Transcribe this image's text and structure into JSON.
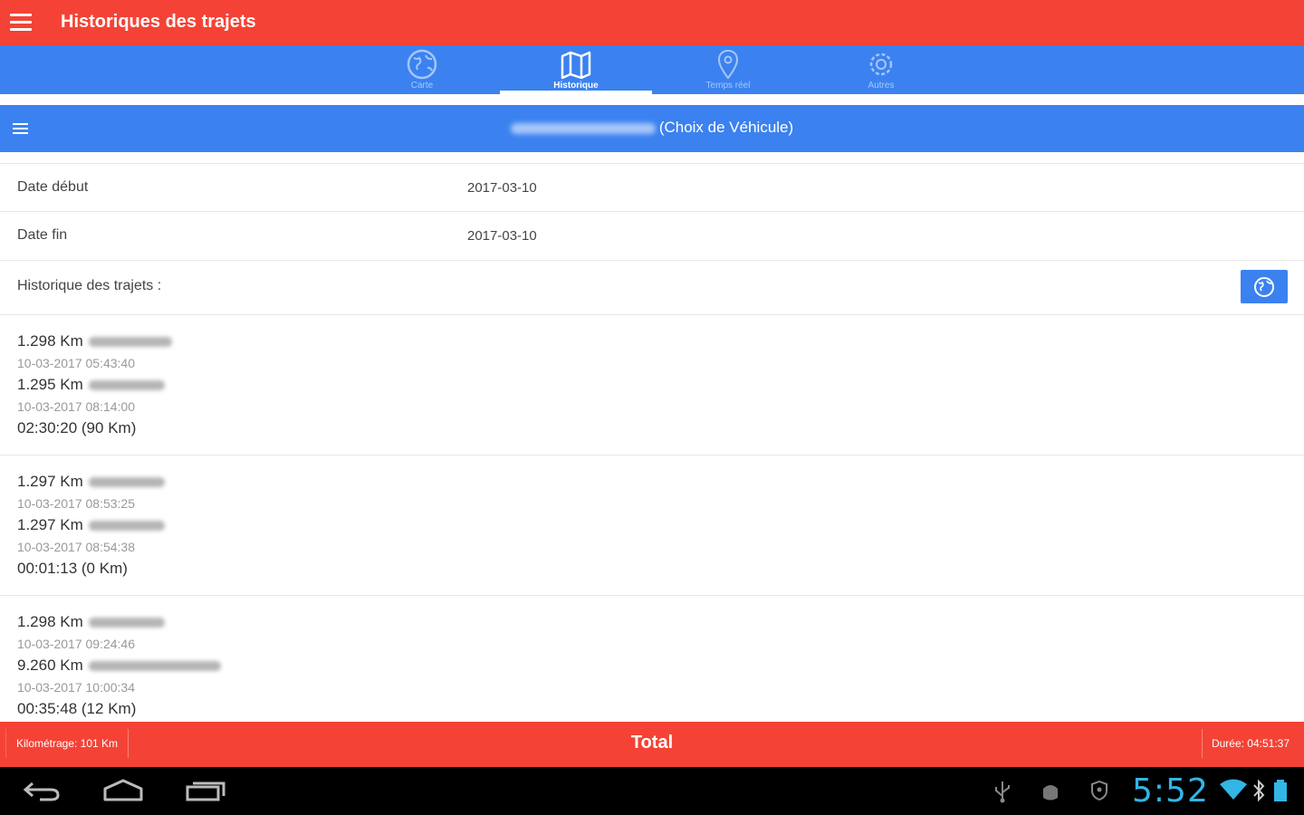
{
  "app": {
    "title": "Historiques des trajets"
  },
  "tabs": [
    {
      "label": "Carte",
      "icon": "globe-icon",
      "active": false
    },
    {
      "label": "Historique",
      "icon": "map-icon",
      "active": true
    },
    {
      "label": "Temps réel",
      "icon": "location-pin-icon",
      "active": false
    },
    {
      "label": "Autres",
      "icon": "settings-icon",
      "active": false
    }
  ],
  "vehicle": {
    "label": "(Choix de Véhicule)"
  },
  "filters": {
    "date_debut_label": "Date début",
    "date_debut_value": "2017-03-10",
    "date_fin_label": "Date fin",
    "date_fin_value": "2017-03-10",
    "history_label": "Historique des trajets :"
  },
  "trips": [
    {
      "start_km": "1.298 Km",
      "start_time": "10-03-2017 05:43:40",
      "end_km": "1.295 Km",
      "end_time": "10-03-2017 08:14:00",
      "duration": "02:30:20 (90 Km)"
    },
    {
      "start_km": "1.297 Km",
      "start_time": "10-03-2017 08:53:25",
      "end_km": "1.297 Km",
      "end_time": "10-03-2017 08:54:38",
      "duration": "00:01:13 (0 Km)"
    },
    {
      "start_km": "1.298 Km",
      "start_time": "10-03-2017 09:24:46",
      "end_km": "9.260 Km",
      "end_time": "10-03-2017 10:00:34",
      "duration": "00:35:48 (12 Km)"
    }
  ],
  "footer": {
    "kilometrage": "Kilométrage: 101 Km",
    "total": "Total",
    "duree": "Durée: 04:51:37"
  },
  "system": {
    "clock": "5:52"
  },
  "colors": {
    "primary_red": "#F44336",
    "primary_blue": "#3B82F0",
    "clock_blue": "#33B5E5"
  }
}
